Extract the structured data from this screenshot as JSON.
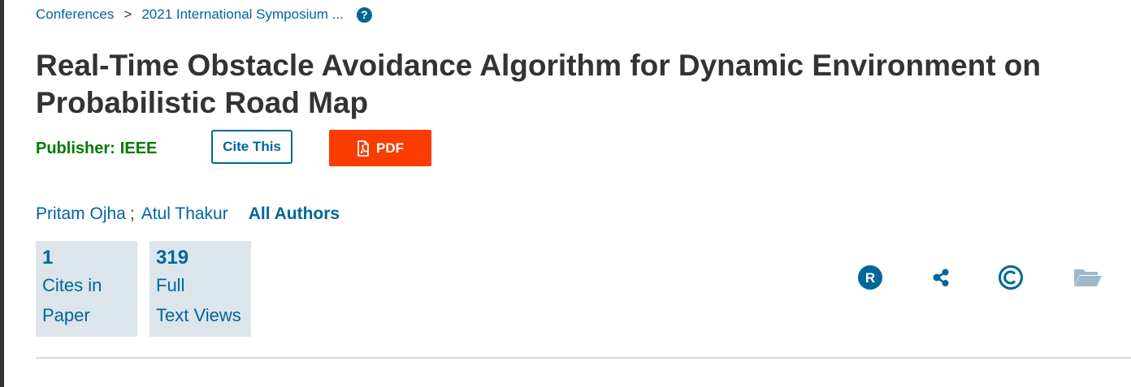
{
  "breadcrumb": {
    "items": [
      "Conferences",
      "2021 International Symposium ..."
    ],
    "separator": ">",
    "help_icon": "question-circle-icon"
  },
  "title": {
    "line1": "Real-Time Obstacle Avoidance Algorithm for Dynamic Environment on",
    "line2": "Probabilistic Road Map"
  },
  "publisher": {
    "label": "Publisher:",
    "value": "IEEE"
  },
  "actions": {
    "cite_label": "Cite This",
    "pdf_label": "PDF",
    "pdf_icon": "pdf-file-icon"
  },
  "authors": {
    "names": [
      "Pritam Ojha",
      "Atul Thakur"
    ],
    "separator": ";",
    "all_label": "All Authors"
  },
  "metrics": [
    {
      "value": "1",
      "line1": "Cites in",
      "line2": "Paper"
    },
    {
      "value": "319",
      "line1": "Full",
      "line2": "Text Views"
    }
  ],
  "toolbar_icons": [
    "rights-r-icon",
    "share-icon",
    "copyright-icon",
    "folder-icon"
  ],
  "colors": {
    "link": "#006699",
    "publisher": "#007a00",
    "pdf_button": "#fa3c00",
    "metric_bg": "#dbe5eb",
    "folder_icon": "#9fb9cc"
  }
}
